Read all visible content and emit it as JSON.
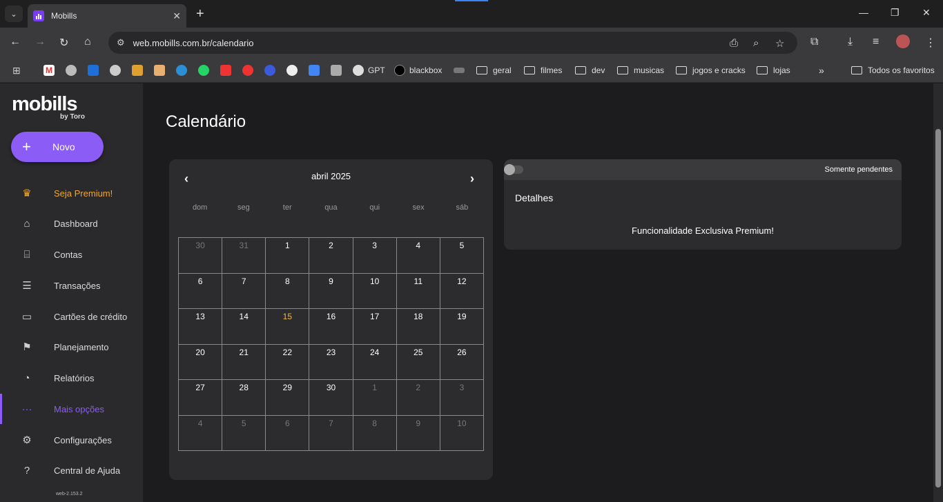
{
  "browser": {
    "tab_title": "Mobills",
    "url": "web.mobills.com.br/calendario",
    "bookmarks": [
      "GPT",
      "blackbox",
      "geral",
      "filmes",
      "dev",
      "musicas",
      "jogos e cracks",
      "lojas"
    ],
    "all_bookmarks": "Todos os favoritos"
  },
  "sidebar": {
    "logo": "mobills",
    "logo_sub": "by Toro",
    "new_button": "Novo",
    "items": [
      {
        "label": "Seja Premium!",
        "icon": "crown-icon"
      },
      {
        "label": "Dashboard",
        "icon": "home-icon"
      },
      {
        "label": "Contas",
        "icon": "bank-icon"
      },
      {
        "label": "Transações",
        "icon": "list-icon"
      },
      {
        "label": "Cartões de crédito",
        "icon": "card-icon"
      },
      {
        "label": "Planejamento",
        "icon": "flag-icon"
      },
      {
        "label": "Relatórios",
        "icon": "pie-icon"
      },
      {
        "label": "Mais opções",
        "icon": "dots-icon"
      },
      {
        "label": "Configurações",
        "icon": "gear-icon"
      },
      {
        "label": "Central de Ajuda",
        "icon": "help-icon"
      }
    ],
    "version": "web-2.153.2"
  },
  "page": {
    "title": "Calendário"
  },
  "calendar": {
    "month": "abril 2025",
    "weekdays": [
      "dom",
      "seg",
      "ter",
      "qua",
      "qui",
      "sex",
      "sáb"
    ],
    "weeks": [
      [
        "30",
        "31",
        "1",
        "2",
        "3",
        "4",
        "5"
      ],
      [
        "6",
        "7",
        "8",
        "9",
        "10",
        "11",
        "12"
      ],
      [
        "13",
        "14",
        "15",
        "16",
        "17",
        "18",
        "19"
      ],
      [
        "20",
        "21",
        "22",
        "23",
        "24",
        "25",
        "26"
      ],
      [
        "27",
        "28",
        "29",
        "30",
        "1",
        "2",
        "3"
      ],
      [
        "4",
        "5",
        "6",
        "7",
        "8",
        "9",
        "10"
      ]
    ],
    "today": "15"
  },
  "details": {
    "toggle_label": "Somente pendentes",
    "title": "Detalhes",
    "message": "Funcionalidade Exclusiva Premium!"
  },
  "colors": {
    "accent": "#8b5cf6",
    "premium": "#f5a623",
    "today": "#f5b82e"
  }
}
